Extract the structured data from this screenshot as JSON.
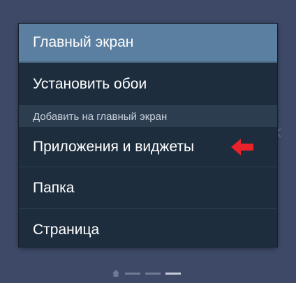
{
  "dialog": {
    "title": "Главный экран",
    "items": {
      "set_wallpaper": "Установить обои",
      "section_header": "Добавить на главный экран",
      "apps_widgets": "Приложения и виджеты",
      "folder": "Папка",
      "page": "Страница"
    }
  },
  "annotation": {
    "arrow_color": "#e8232a"
  },
  "page_indicator": {
    "page_count": 3,
    "current_page": 3
  }
}
